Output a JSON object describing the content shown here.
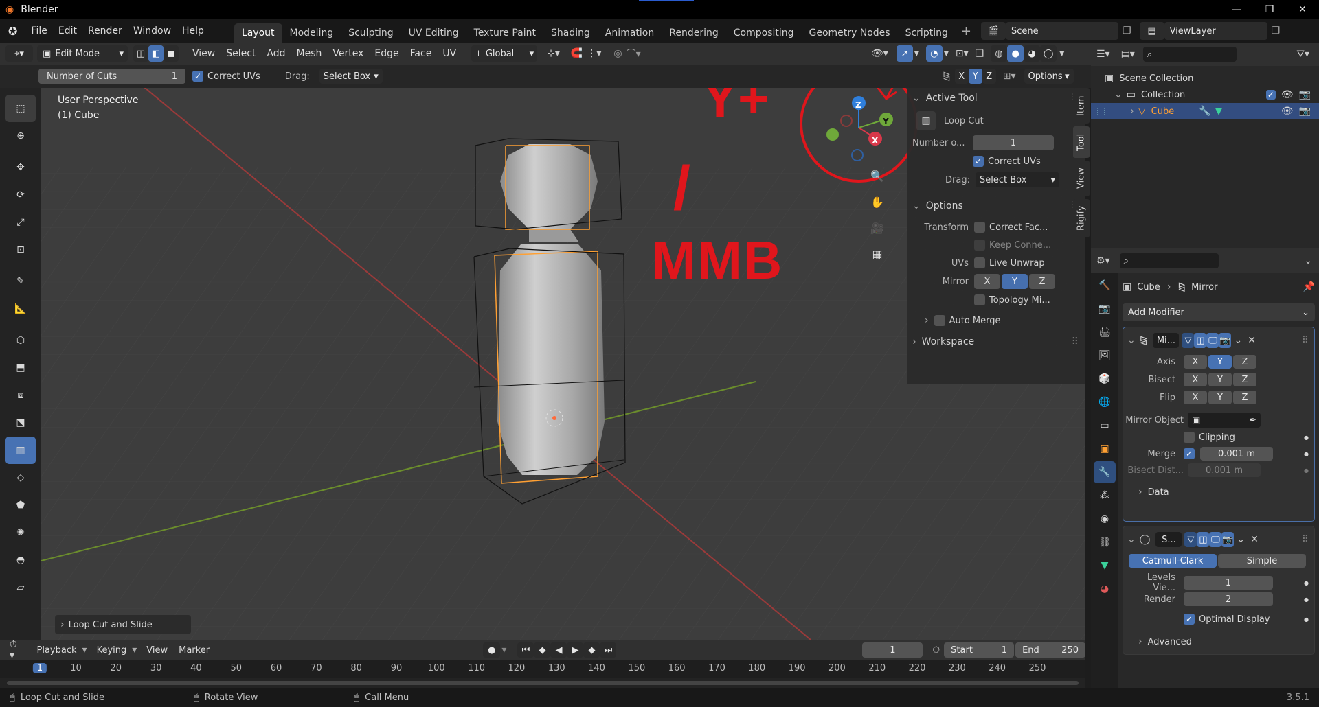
{
  "app": {
    "title": "Blender",
    "version": "3.5.1"
  },
  "window_controls": {
    "minimize": "—",
    "maximize": "❐",
    "close": "✕"
  },
  "menus": [
    "File",
    "Edit",
    "Render",
    "Window",
    "Help"
  ],
  "workspaces": [
    "Layout",
    "Modeling",
    "Sculpting",
    "UV Editing",
    "Texture Paint",
    "Shading",
    "Animation",
    "Rendering",
    "Compositing",
    "Geometry Nodes",
    "Scripting"
  ],
  "active_workspace": "Layout",
  "add_workspace": "+",
  "scene": {
    "name": "Scene",
    "view_layer": "ViewLayer"
  },
  "header": {
    "mode": "Edit Mode",
    "menus": [
      "View",
      "Select",
      "Add",
      "Mesh",
      "Vertex",
      "Edge",
      "Face",
      "UV"
    ],
    "orientation": "Global"
  },
  "tool_settings": {
    "cuts_label": "Number of Cuts",
    "cuts_value": "1",
    "correct_uvs": "Correct UVs",
    "drag_label": "Drag:",
    "drag_value": "Select Box",
    "options": "Options",
    "axes": [
      "X",
      "Y",
      "Z"
    ]
  },
  "viewport": {
    "perspective": "User Perspective",
    "object": "(1) Cube",
    "annotation_top": "Y+",
    "annotation_slash": "/",
    "annotation_bottom": "MMB",
    "operator_panel": "Loop Cut and Slide",
    "gizmo": {
      "z": "Z",
      "y": "Y",
      "x": "X"
    }
  },
  "npanel": {
    "tabs": [
      "Item",
      "Tool",
      "View",
      "Rigify"
    ],
    "active_tab": "Tool",
    "active_tool_header": "Active Tool",
    "tool_name": "Loop Cut",
    "number_label": "Number o...",
    "number_value": "1",
    "correct_uvs": "Correct UVs",
    "drag_label": "Drag:",
    "drag_value": "Select Box",
    "options_header": "Options",
    "transform_label": "Transform",
    "correct_face": "Correct Fac...",
    "keep_connected": "Keep Conne...",
    "uvs_label": "UVs",
    "live_unwrap": "Live Unwrap",
    "mirror_label": "Mirror",
    "mirror_axes": [
      "X",
      "Y",
      "Z"
    ],
    "topology_mirror": "Topology Mi...",
    "auto_merge": "Auto Merge",
    "workspace": "Workspace"
  },
  "outliner": {
    "scene_collection": "Scene Collection",
    "collection": "Collection",
    "object": "Cube"
  },
  "properties": {
    "breadcrumb_object": "Cube",
    "breadcrumb_modifier": "Mirror",
    "add_modifier": "Add Modifier",
    "mirror_modifier": {
      "name": "Mi...",
      "axis_label": "Axis",
      "bisect_label": "Bisect",
      "flip_label": "Flip",
      "axes": [
        "X",
        "Y",
        "Z"
      ],
      "mirror_object": "Mirror Object",
      "clipping": "Clipping",
      "merge_label": "Merge",
      "merge_value": "0.001 m",
      "bisect_dist_label": "Bisect Dist...",
      "bisect_dist_value": "0.001 m",
      "data": "Data"
    },
    "subsurf_modifier": {
      "name": "S...",
      "catmull": "Catmull-Clark",
      "simple": "Simple",
      "levels_label": "Levels Vie...",
      "levels_value": "1",
      "render_label": "Render",
      "render_value": "2",
      "optimal_display": "Optimal Display",
      "advanced": "Advanced"
    }
  },
  "timeline": {
    "menus": [
      "Playback",
      "Keying",
      "View",
      "Marker"
    ],
    "current_frame": "1",
    "start_label": "Start",
    "start_value": "1",
    "end_label": "End",
    "end_value": "250",
    "ruler": [
      "1",
      "10",
      "20",
      "30",
      "40",
      "50",
      "60",
      "70",
      "80",
      "90",
      "100",
      "110",
      "120",
      "130",
      "140",
      "150",
      "160",
      "170",
      "180",
      "190",
      "200",
      "210",
      "220",
      "230",
      "240",
      "250"
    ]
  },
  "statusbar": {
    "left": "Loop Cut and Slide",
    "middle": "Rotate View",
    "right": "Call Menu"
  },
  "colors": {
    "accent": "#4772b3",
    "annotation": "#e0161c",
    "selection_edge": "#ffa033"
  }
}
